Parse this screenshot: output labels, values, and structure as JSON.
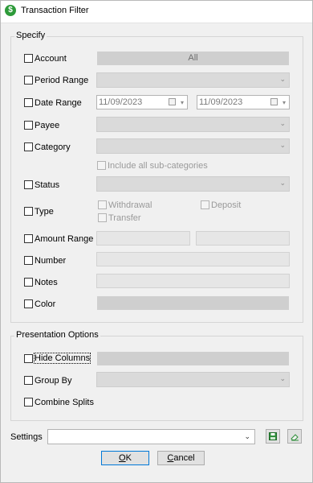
{
  "window": {
    "title": "Transaction Filter",
    "icon": "money-app-icon"
  },
  "specify": {
    "label": "Specify",
    "account": {
      "label": "Account",
      "value": "All"
    },
    "period_range": {
      "label": "Period Range"
    },
    "date_range": {
      "label": "Date Range",
      "from": "11/09/2023",
      "to": "11/09/2023"
    },
    "payee": {
      "label": "Payee"
    },
    "category": {
      "label": "Category",
      "include_sub": "Include all sub-categories"
    },
    "status": {
      "label": "Status"
    },
    "type": {
      "label": "Type",
      "withdrawal": "Withdrawal",
      "deposit": "Deposit",
      "transfer": "Transfer"
    },
    "amount_range": {
      "label": "Amount Range"
    },
    "number": {
      "label": "Number"
    },
    "notes": {
      "label": "Notes"
    },
    "color": {
      "label": "Color"
    }
  },
  "presentation": {
    "label": "Presentation Options",
    "hide_columns": {
      "label": "Hide Columns"
    },
    "group_by": {
      "label": "Group By"
    },
    "combine_splits": {
      "label": "Combine Splits"
    }
  },
  "settings": {
    "label": "Settings"
  },
  "buttons": {
    "ok_u": "O",
    "ok_rest": "K",
    "cancel_u": "C",
    "cancel_rest": "ancel"
  }
}
